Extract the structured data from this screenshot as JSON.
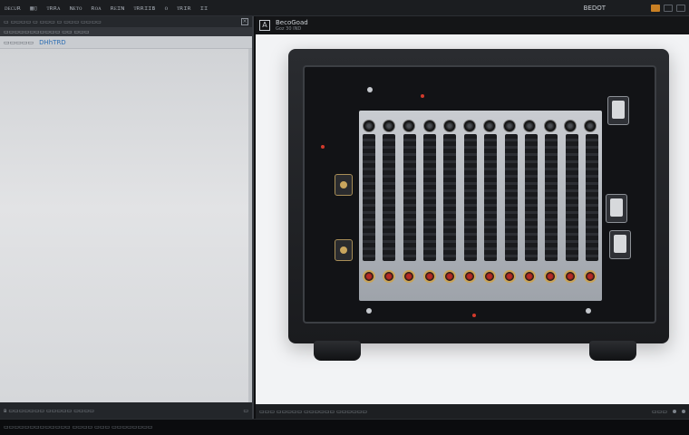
{
  "menubar": {
    "items": [
      "ᴅᴇᴄᴜʀ",
      "▦▯",
      "ᴛʀʀᴀ",
      "ɴᴇᴛᴏ",
      "ʀᴏᴀ",
      "ʀᴇɪɴ",
      "ᴛʀʀɪɪʙ",
      "ᴏ",
      "ᴛʀɪʀ",
      "ɪɪ"
    ],
    "brand": "BEDOT"
  },
  "left_panel": {
    "toolbar": "▭  ▭▭▭▭ ▭ ▭▭▭ ▭ ▭▭▭ ▭▭▭▭",
    "tabs": "▭▭▭▭▭▭▭▭▭▭▭ ▭▭ ▭▭▭",
    "header_grey": "▭▭▭▭▭",
    "header_link": "DHhTRD",
    "status": "ʙ ▭▭▭▭▭▭▭ ▭▭▭▭▭ ▭▭▭▭",
    "status_right": "▭"
  },
  "right_panel": {
    "title": "BecoGoad",
    "subtitle": "Goz 30 IND",
    "status_left": "▭▭▭ ▭▭▭▭▭ ▭▭▭▭▭▭ ▭▭▭▭▭▭",
    "status_right": "▭▭▭"
  },
  "bottombar": {
    "text": "▭▭▭▭▭▭▭▭▭▭▭▭▭ ▭▭▭▭ ▭▭▭ ▭▭▭▭▭▭▭▭"
  },
  "colors": {
    "accent": "#2e6fb3",
    "warning": "#c98024",
    "jack_red": "#b62a24"
  }
}
